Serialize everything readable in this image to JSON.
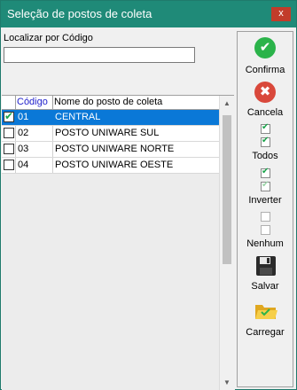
{
  "window": {
    "title": "Seleção de postos de coleta",
    "close_label": "x"
  },
  "search": {
    "label": "Localizar por Código",
    "value": "",
    "placeholder": ""
  },
  "table": {
    "columns": [
      "Código",
      "Nome do posto de coleta"
    ],
    "rows": [
      {
        "code": "01",
        "name": "CENTRAL",
        "checked": true,
        "selected": true
      },
      {
        "code": "02",
        "name": "POSTO UNIWARE SUL",
        "checked": false,
        "selected": false
      },
      {
        "code": "03",
        "name": "POSTO UNIWARE NORTE",
        "checked": false,
        "selected": false
      },
      {
        "code": "04",
        "name": "POSTO UNIWARE OESTE",
        "checked": false,
        "selected": false
      }
    ]
  },
  "toolbar": {
    "confirm": {
      "label": "Confirma",
      "icon": "check-circle-icon",
      "color": "#2bb34a"
    },
    "cancel": {
      "label": "Cancela",
      "icon": "x-circle-icon",
      "color": "#d9483b"
    },
    "all": {
      "label": "Todos",
      "icon": "checkboxes-checked-icon"
    },
    "invert": {
      "label": "Inverter",
      "icon": "checkboxes-invert-icon"
    },
    "none": {
      "label": "Nenhum",
      "icon": "checkboxes-empty-icon"
    },
    "save": {
      "label": "Salvar",
      "icon": "floppy-disk-icon"
    },
    "load": {
      "label": "Carregar",
      "icon": "folder-open-icon"
    }
  }
}
